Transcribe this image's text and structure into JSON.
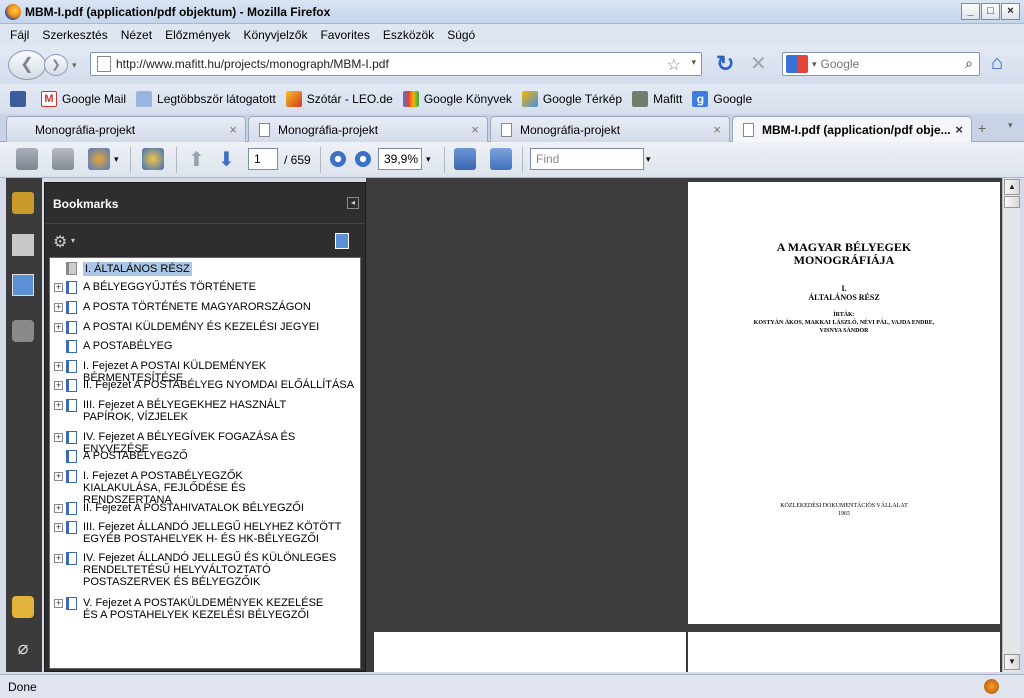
{
  "window": {
    "title": "MBM-I.pdf (application/pdf objektum) - Mozilla Firefox"
  },
  "menu": [
    "Fájl",
    "Szerkesztés",
    "Nézet",
    "Előzmények",
    "Könyvjelzők",
    "Favorites",
    "Eszközök",
    "Súgó"
  ],
  "nav": {
    "url": "http://www.mafitt.hu/projects/monograph/MBM-I.pdf",
    "search_placeholder": "Google"
  },
  "bookmarks_toolbar": [
    "Google Mail",
    "Legtöbbször látogatott",
    "Szótár - LEO.de",
    "Google Könyvek",
    "Google Térkép",
    "Mafitt",
    "Google"
  ],
  "tabs": [
    {
      "label": "Monográfia-projekt"
    },
    {
      "label": "Monográfia-projekt"
    },
    {
      "label": "Monográfia-projekt"
    },
    {
      "label": "MBM-I.pdf (application/pdf obje..."
    }
  ],
  "pdf_toolbar": {
    "page": "1",
    "page_total": "/ 659",
    "zoom": "39,9%",
    "find_placeholder": "Find"
  },
  "bookmarks_panel": {
    "title": "Bookmarks",
    "items": [
      {
        "label": "I. ÁLTALÁNOS RÉSZ",
        "expandable": false,
        "selected": true
      },
      {
        "label": "A BÉLYEGGYŰJTÉS TÖRTÉNETE",
        "expandable": true
      },
      {
        "label": "A POSTA TÖRTÉNETE MAGYARORSZÁGON",
        "expandable": true
      },
      {
        "label": "A POSTAI KÜLDEMÉNY ÉS KEZELÉSI JEGYEI",
        "expandable": true
      },
      {
        "label": "A POSTABÉLYEG",
        "expandable": false
      },
      {
        "label": "I. Fejezet  A POSTAI KÜLDEMÉNYEK BÉRMENTESÍTÉSE",
        "expandable": true
      },
      {
        "label": "II. Fejezet A POSTABÉLYEG NYOMDAI ELŐÁLLÍTÁSA",
        "expandable": true
      },
      {
        "label": "III. Fejezet A BÉLYEGEKHEZ HASZNÁLT PAPÍROK, VÍZJELEK",
        "expandable": true
      },
      {
        "label": "IV. Fejezet A BÉLYEGÍVEK FOGAZÁSA ÉS ENYVEZÉSE",
        "expandable": true
      },
      {
        "label": "A POSTABÉLYEGZŐ",
        "expandable": false
      },
      {
        "label": "I. Fejezet A POSTABÉLYEGZŐK KIALAKULÁSA, FEJLŐDÉSE ÉS RENDSZERTANA",
        "expandable": true
      },
      {
        "label": "II. Fejezet A POSTAHIVATALOK BÉLYEGZŐI",
        "expandable": true
      },
      {
        "label": "III. Fejezet ÁLLANDÓ JELLEGŰ HELYHEZ KÖTÖTT EGYÉB POSTAHELYEK H- ÉS HK-BÉLYEGZŐI",
        "expandable": true
      },
      {
        "label": "IV. Fejezet  ÁLLANDÓ JELLEGŰ ÉS KÜLÖNLEGES RENDELTETÉSŰ HELYVÁLTOZTATÓ POSTASZERVEK ÉS BÉLYEGZŐIK",
        "expandable": true
      },
      {
        "label": "V. Fejezet  A POSTAKÜLDEMÉNYEK KEZELÉSE ÉS A POSTAHELYEK KEZELÉSI BÉLYEGZŐI",
        "expandable": true
      }
    ]
  },
  "document": {
    "title_line1": "A MAGYAR BÉLYEGEK",
    "title_line2": "MONOGRÁFIÁJA",
    "volume": "I.",
    "part": "ÁLTALÁNOS RÉSZ",
    "authors_label": "ÍRTÁK:",
    "authors_line1": "KOSTYÁN ÁKOS, MAKKAI LÁSZLÓ, NÉVI PÁL, VAJDA ENDRE,",
    "authors_line2": "VISNYA SÁNDOR",
    "publisher": "KÖZLEKEDÉSI DOKUMENTÁCIÓS VÁLLALAT",
    "year": "1965"
  },
  "status": {
    "text": "Done"
  }
}
